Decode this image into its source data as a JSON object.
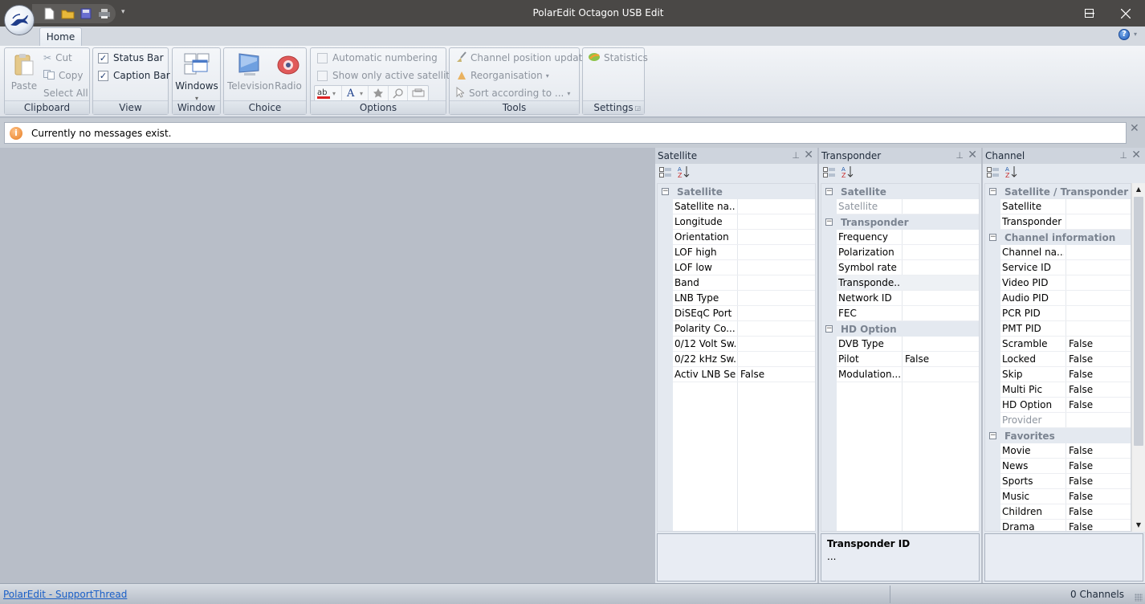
{
  "window": {
    "title": "PolarEdit Octagon USB Edit",
    "controls": {
      "minimize": "—",
      "maximize": "☐",
      "close": "✕"
    }
  },
  "quick_access": {
    "items": [
      {
        "name": "new-icon"
      },
      {
        "name": "open-icon"
      },
      {
        "name": "save-icon"
      },
      {
        "name": "print-icon"
      }
    ],
    "more": "▾"
  },
  "tabs": [
    {
      "label": "Home",
      "active": true
    }
  ],
  "help": {
    "label": "?",
    "more": "▾"
  },
  "ribbon": {
    "clipboard": {
      "label": "Clipboard",
      "paste": "Paste",
      "cut": "Cut",
      "copy": "Copy",
      "select_all": "Select All"
    },
    "view": {
      "label": "View",
      "status_bar": {
        "label": "Status Bar",
        "checked": true
      },
      "caption_bar": {
        "label": "Caption Bar",
        "checked": true
      }
    },
    "window": {
      "label": "Window",
      "windows": "Windows",
      "dropdown": "▾"
    },
    "choice": {
      "label": "Choice",
      "television": "Television",
      "radio": "Radio"
    },
    "options": {
      "label": "Options",
      "automatic_numbering": {
        "label": "Automatic numbering",
        "checked": false
      },
      "show_only_active": {
        "label": "Show only active satellites",
        "checked": false
      },
      "mini_tools": [
        "spelling-icon",
        "font-color-icon",
        "favorite-icon",
        "find-icon",
        "layout-icon"
      ]
    },
    "tools": {
      "label": "Tools",
      "channel_position_update": "Channel position update",
      "reorganisation": "Reorganisation",
      "sort_according": "Sort according to ..."
    },
    "settings": {
      "label": "Settings",
      "statistics": "Statistics"
    }
  },
  "message_bar": {
    "text": "Currently no messages exist.",
    "close": "✕"
  },
  "panels": {
    "satellite": {
      "title": "Satellite",
      "categories": [
        {
          "name": "Satellite",
          "rows": [
            {
              "name": "Satellite na...",
              "value": ""
            },
            {
              "name": "Longitude",
              "value": ""
            },
            {
              "name": "Orientation",
              "value": ""
            },
            {
              "name": "LOF high",
              "value": ""
            },
            {
              "name": "LOF low",
              "value": ""
            },
            {
              "name": "Band",
              "value": ""
            },
            {
              "name": "LNB Type",
              "value": ""
            },
            {
              "name": "DiSEqC Port",
              "value": ""
            },
            {
              "name": "Polarity Co...",
              "value": ""
            },
            {
              "name": "0/12 Volt Sw...",
              "value": ""
            },
            {
              "name": "0/22 kHz Sw...",
              "value": ""
            },
            {
              "name": "Activ LNB Set",
              "value": "False"
            }
          ]
        }
      ],
      "description": {
        "title": "",
        "text": ""
      }
    },
    "transponder": {
      "title": "Transponder",
      "categories": [
        {
          "name": "Satellite",
          "rows": [
            {
              "name": "Satellite",
              "value": "",
              "readonly": true
            }
          ]
        },
        {
          "name": "Transponder",
          "rows": [
            {
              "name": "Frequency",
              "value": ""
            },
            {
              "name": "Polarization",
              "value": ""
            },
            {
              "name": "Symbol rate",
              "value": ""
            },
            {
              "name": "Transponde...",
              "value": "",
              "selected": true
            },
            {
              "name": "Network ID",
              "value": ""
            },
            {
              "name": "FEC",
              "value": ""
            }
          ]
        },
        {
          "name": "HD Option",
          "rows": [
            {
              "name": "DVB Type",
              "value": ""
            },
            {
              "name": "Pilot",
              "value": "False"
            },
            {
              "name": "Modulation...",
              "value": ""
            }
          ]
        }
      ],
      "description": {
        "title": "Transponder ID",
        "text": "..."
      }
    },
    "channel": {
      "title": "Channel",
      "categories": [
        {
          "name": "Satellite / Transponder",
          "rows": [
            {
              "name": "Satellite",
              "value": ""
            },
            {
              "name": "Transponder",
              "value": ""
            }
          ]
        },
        {
          "name": "Channel information",
          "rows": [
            {
              "name": "Channel na...",
              "value": ""
            },
            {
              "name": "Service ID",
              "value": ""
            },
            {
              "name": "Video PID",
              "value": ""
            },
            {
              "name": "Audio PID",
              "value": ""
            },
            {
              "name": "PCR PID",
              "value": ""
            },
            {
              "name": "PMT PID",
              "value": ""
            },
            {
              "name": "Scramble",
              "value": "False"
            },
            {
              "name": "Locked",
              "value": "False"
            },
            {
              "name": "Skip",
              "value": "False"
            },
            {
              "name": "Multi Pic",
              "value": "False"
            },
            {
              "name": "HD Option",
              "value": "False"
            },
            {
              "name": "Provider",
              "value": "",
              "readonly": true
            }
          ]
        },
        {
          "name": "Favorites",
          "rows": [
            {
              "name": "Movie",
              "value": "False"
            },
            {
              "name": "News",
              "value": "False"
            },
            {
              "name": "Sports",
              "value": "False"
            },
            {
              "name": "Music",
              "value": "False"
            },
            {
              "name": "Children",
              "value": "False"
            },
            {
              "name": "Drama",
              "value": "False"
            }
          ]
        }
      ],
      "description": {
        "title": "",
        "text": ""
      }
    }
  },
  "status_bar": {
    "link": "PolarEdit - SupportThread",
    "channel_count": "0 Channels"
  },
  "colors": {
    "titlebar": "#4a4846",
    "ribbon": "#e8ecf1",
    "workspace": "#b8bec8",
    "link": "#1a5fc7"
  }
}
